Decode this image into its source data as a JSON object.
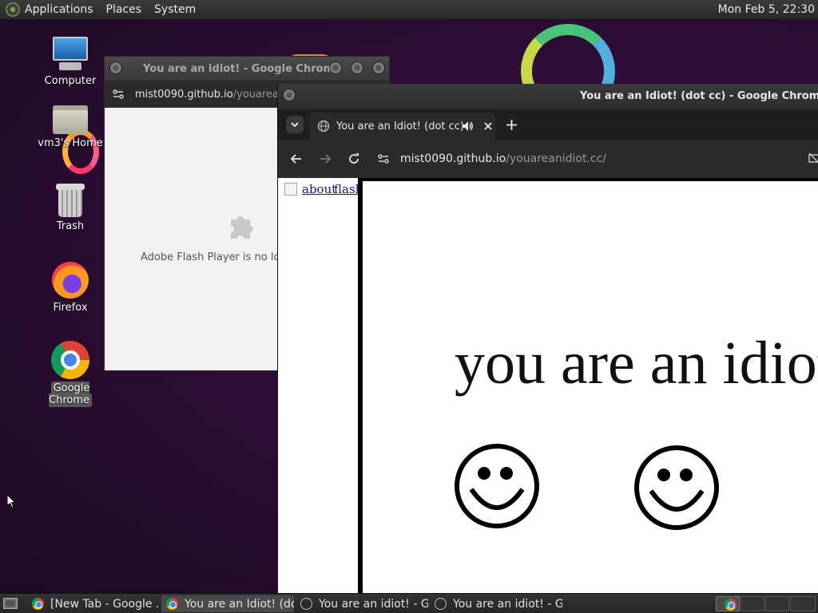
{
  "top_panel": {
    "menus": [
      "Applications",
      "Places",
      "System"
    ],
    "clock": "Mon Feb  5, 22:30"
  },
  "desktop_icons": [
    {
      "label": "Computer"
    },
    {
      "label": "vm3's Home"
    },
    {
      "label": "Trash"
    },
    {
      "label": "Firefox"
    },
    {
      "label": "Google Chrome"
    }
  ],
  "window_back": {
    "title": "You are an idiot! - Google Chrome",
    "url_host": "mist0090.github.io",
    "url_path": "/youarear",
    "flash_message": "Adobe Flash Player is no lonc"
  },
  "window_front": {
    "title": "You are an Idiot! (dot cc) - Google Chrome",
    "tab_title": "You are an Idiot! (dot cc)",
    "url_host": "mist0090.github.io",
    "url_path": "/youareanidiot.cc/",
    "links": [
      "about",
      "flash"
    ],
    "page_text": "you are an idiot"
  },
  "taskbar": {
    "tasks": [
      {
        "label": "[New Tab - Google ..."
      },
      {
        "label": "You are an Idiot! (do..."
      },
      {
        "label": "You are an idiot! - G..."
      },
      {
        "label": "You are an idiot! - G..."
      }
    ]
  },
  "colors": {
    "desktop": "#2e0d36",
    "panel": "#2f2f2f",
    "chrome_dark": "#2b2b2b",
    "link": "#1a0dab"
  }
}
